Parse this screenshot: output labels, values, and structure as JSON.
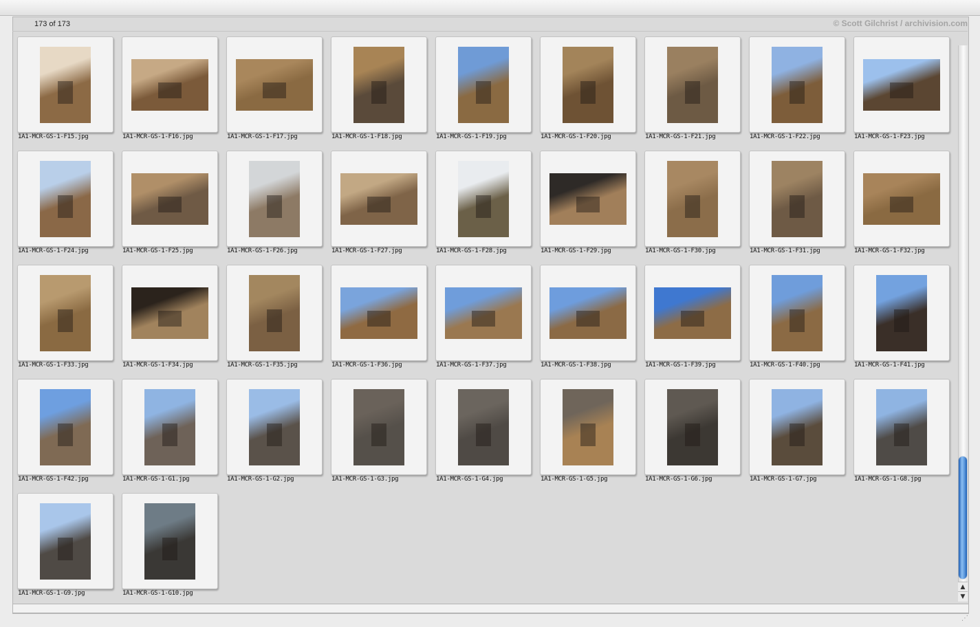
{
  "header": {
    "counter": "173 of 173",
    "credit": "© Scott Gilchrist / archivision.com"
  },
  "scrollbar": {
    "up_arrow": "▲",
    "down_arrow": "▼",
    "position": 0.9
  },
  "thumbnails": [
    {
      "name": "1A1-MCR-GS-1-F15.jpg",
      "orientation": "portrait",
      "sky": "#e7d9c5",
      "wall": "#8c6a45"
    },
    {
      "name": "1A1-MCR-GS-1-F16.jpg",
      "orientation": "landscape",
      "sky": "#c6a985",
      "wall": "#7b5a3a"
    },
    {
      "name": "1A1-MCR-GS-1-F17.jpg",
      "orientation": "landscape",
      "sky": "#a9875c",
      "wall": "#8a6a42"
    },
    {
      "name": "1A1-MCR-GS-1-F18.jpg",
      "orientation": "portrait",
      "sky": "#a88455",
      "wall": "#5a4a3a"
    },
    {
      "name": "1A1-MCR-GS-1-F19.jpg",
      "orientation": "portrait",
      "sky": "#6f9bd6",
      "wall": "#8a6a42"
    },
    {
      "name": "1A1-MCR-GS-1-F20.jpg",
      "orientation": "portrait",
      "sky": "#a3845a",
      "wall": "#6e5234"
    },
    {
      "name": "1A1-MCR-GS-1-F21.jpg",
      "orientation": "portrait",
      "sky": "#9a8060",
      "wall": "#6d5a44"
    },
    {
      "name": "1A1-MCR-GS-1-F22.jpg",
      "orientation": "portrait",
      "sky": "#8fb2e2",
      "wall": "#7d5d3a"
    },
    {
      "name": "1A1-MCR-GS-1-F23.jpg",
      "orientation": "landscape",
      "sky": "#9cc0ec",
      "wall": "#5b4632"
    },
    {
      "name": "1A1-MCR-GS-1-F24.jpg",
      "orientation": "portrait",
      "sky": "#b9cfe9",
      "wall": "#8a6847"
    },
    {
      "name": "1A1-MCR-GS-1-F25.jpg",
      "orientation": "landscape",
      "sky": "#b08f68",
      "wall": "#6f5a45"
    },
    {
      "name": "1A1-MCR-GS-1-F26.jpg",
      "orientation": "portrait",
      "sky": "#d3d6d8",
      "wall": "#8d7a65"
    },
    {
      "name": "1A1-MCR-GS-1-F27.jpg",
      "orientation": "landscape",
      "sky": "#c2a884",
      "wall": "#7f6448"
    },
    {
      "name": "1A1-MCR-GS-1-F28.jpg",
      "orientation": "portrait",
      "sky": "#e9ecef",
      "wall": "#6b6048"
    },
    {
      "name": "1A1-MCR-GS-1-F29.jpg",
      "orientation": "landscape",
      "sky": "#2e2a27",
      "wall": "#a17f5a"
    },
    {
      "name": "1A1-MCR-GS-1-F30.jpg",
      "orientation": "portrait",
      "sky": "#a88862",
      "wall": "#8b6d4a"
    },
    {
      "name": "1A1-MCR-GS-1-F31.jpg",
      "orientation": "portrait",
      "sky": "#9d8362",
      "wall": "#6e5a45"
    },
    {
      "name": "1A1-MCR-GS-1-F32.jpg",
      "orientation": "landscape",
      "sky": "#a8845a",
      "wall": "#8a6a42"
    },
    {
      "name": "1A1-MCR-GS-1-F33.jpg",
      "orientation": "portrait",
      "sky": "#b89a6f",
      "wall": "#8a6a42"
    },
    {
      "name": "1A1-MCR-GS-1-F34.jpg",
      "orientation": "landscape",
      "sky": "#2b231c",
      "wall": "#a1835d"
    },
    {
      "name": "1A1-MCR-GS-1-F35.jpg",
      "orientation": "portrait",
      "sky": "#a3875f",
      "wall": "#7b6043"
    },
    {
      "name": "1A1-MCR-GS-1-F36.jpg",
      "orientation": "landscape",
      "sky": "#7aa4dc",
      "wall": "#8f6a42"
    },
    {
      "name": "1A1-MCR-GS-1-F37.jpg",
      "orientation": "landscape",
      "sky": "#6f9ddb",
      "wall": "#9a7850"
    },
    {
      "name": "1A1-MCR-GS-1-F38.jpg",
      "orientation": "landscape",
      "sky": "#6e9ddd",
      "wall": "#8b6a45"
    },
    {
      "name": "1A1-MCR-GS-1-F39.jpg",
      "orientation": "landscape",
      "sky": "#3f78d0",
      "wall": "#8d6c46"
    },
    {
      "name": "1A1-MCR-GS-1-F40.jpg",
      "orientation": "portrait",
      "sky": "#6f9ddb",
      "wall": "#8b6a44"
    },
    {
      "name": "1A1-MCR-GS-1-F41.jpg",
      "orientation": "portrait",
      "sky": "#73a2df",
      "wall": "#3a2f28"
    },
    {
      "name": "1A1-MCR-GS-1-F42.jpg",
      "orientation": "portrait",
      "sky": "#6e9fe0",
      "wall": "#7f6a54"
    },
    {
      "name": "1A1-MCR-GS-1-G1.jpg",
      "orientation": "portrait",
      "sky": "#8fb4e2",
      "wall": "#6e6258"
    },
    {
      "name": "1A1-MCR-GS-1-G2.jpg",
      "orientation": "portrait",
      "sky": "#9abce6",
      "wall": "#5a524a"
    },
    {
      "name": "1A1-MCR-GS-1-G3.jpg",
      "orientation": "portrait",
      "sky": "#6a625a",
      "wall": "#55504a"
    },
    {
      "name": "1A1-MCR-GS-1-G4.jpg",
      "orientation": "portrait",
      "sky": "#6b655e",
      "wall": "#4f4a45"
    },
    {
      "name": "1A1-MCR-GS-1-G5.jpg",
      "orientation": "portrait",
      "sky": "#6f655a",
      "wall": "#a88254"
    },
    {
      "name": "1A1-MCR-GS-1-G6.jpg",
      "orientation": "portrait",
      "sky": "#5f5952",
      "wall": "#3c3833"
    },
    {
      "name": "1A1-MCR-GS-1-G7.jpg",
      "orientation": "portrait",
      "sky": "#8fb3e2",
      "wall": "#5a4c3c"
    },
    {
      "name": "1A1-MCR-GS-1-G8.jpg",
      "orientation": "portrait",
      "sky": "#8fb4e2",
      "wall": "#4f4b47"
    },
    {
      "name": "1A1-MCR-GS-1-G9.jpg",
      "orientation": "portrait",
      "sky": "#a9c6ea",
      "wall": "#4f4a45"
    },
    {
      "name": "1A1-MCR-GS-1-G10.jpg",
      "orientation": "portrait",
      "sky": "#6e7c86",
      "wall": "#3a3835"
    }
  ]
}
